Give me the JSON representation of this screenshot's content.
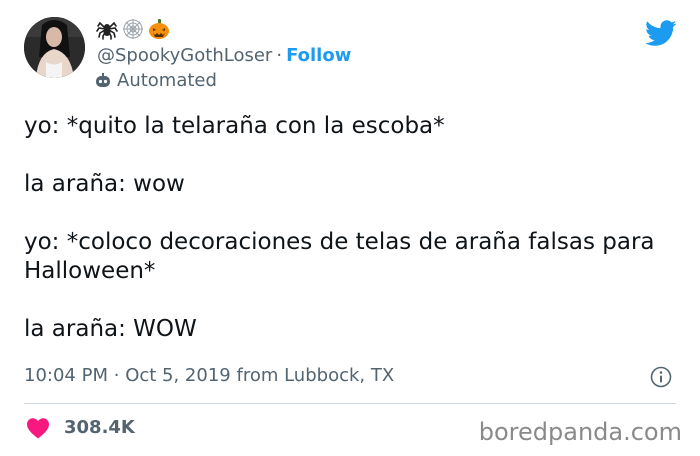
{
  "header": {
    "name_emojis": [
      "spider-emoji",
      "spider-web-emoji",
      "jack-o-lantern-emoji"
    ],
    "handle": "@SpookyGothLoser",
    "separator": "·",
    "follow_label": "Follow",
    "automated_label": "Automated"
  },
  "tweet": {
    "paragraphs": [
      "yo: *quito la telaraña con la escoba*",
      "la araña: wow",
      "yo: *coloco decoraciones de telas de araña falsas para Halloween*",
      "la araña: WOW"
    ]
  },
  "meta": {
    "time": "10:04 PM",
    "separator": "·",
    "date": "Oct 5, 2019",
    "location": "from Lubbock, TX"
  },
  "engagement": {
    "likes": "308.4K"
  },
  "watermark": "boredpanda.com",
  "colors": {
    "twitter_blue": "#1d9bf0",
    "text_primary": "#0f1419",
    "text_secondary": "#536471",
    "heart_red": "#f91880",
    "divider": "#cfd9de"
  }
}
